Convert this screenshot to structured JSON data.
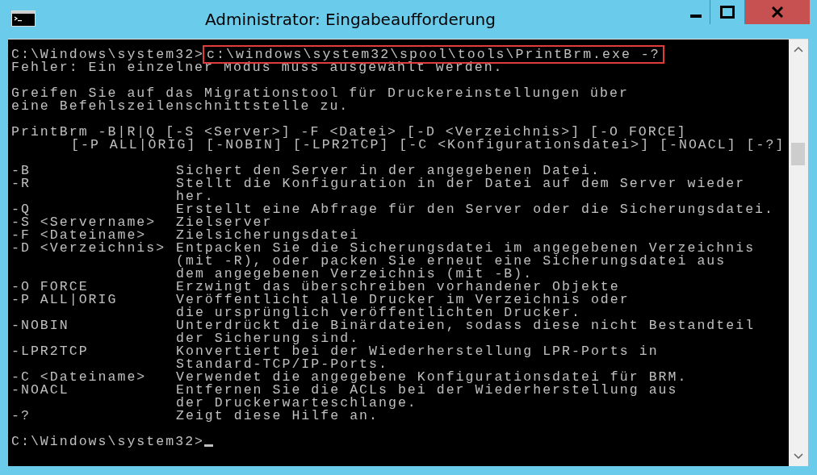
{
  "window": {
    "title": "Administrator: Eingabeaufforderung"
  },
  "prompt": {
    "path": "C:\\Windows\\system32>",
    "command": "c:\\windows\\system32\\spool\\tools\\PrintBrm.exe -?",
    "highlighted": true
  },
  "blocks": [
    {
      "gap_before": false,
      "lines": [
        {
          "text": "Fehler: Ein einzelner Modus muss ausgewählt werden.",
          "continuation": false
        }
      ]
    },
    {
      "gap_before": true,
      "lines": [
        {
          "text": "Greifen Sie auf das Migrationstool für Druckereinstellungen über",
          "continuation": false
        },
        {
          "text": "eine Befehlszeilenschnittstelle zu.",
          "continuation": false
        }
      ]
    },
    {
      "gap_before": true,
      "lines": [
        {
          "text": "PrintBrm -B|R|Q [-S <Server>] -F <Datei> [-D <Verzeichnis>] [-O FORCE]",
          "continuation": false
        },
        {
          "text": "[-P ALL|ORIG] [-NOBIN] [-LPR2TCP] [-C <Konfigurationsdatei>] [-NOACL] [-?]",
          "continuation": true
        }
      ]
    }
  ],
  "options": [
    {
      "flag": "-B",
      "description": [
        "Sichert den Server in der angegebenen Datei."
      ]
    },
    {
      "flag": "-R",
      "description": [
        "Stellt die Konfiguration in der Datei auf dem Server wieder",
        "her."
      ]
    },
    {
      "flag": "-Q",
      "description": [
        "Erstellt eine Abfrage für den Server oder die Sicherungsdatei."
      ]
    },
    {
      "flag": "-S <Servername>",
      "description": [
        "Zielserver"
      ]
    },
    {
      "flag": "-F <Dateiname>",
      "description": [
        "Zielsicherungsdatei"
      ]
    },
    {
      "flag": "-D <Verzeichnis>",
      "description": [
        "Entpacken Sie die Sicherungsdatei im angegebenen Verzeichnis",
        "(mit -R), oder packen Sie erneut eine Sicherungsdatei aus",
        "dem angegebenen Verzeichnis (mit -B)."
      ]
    },
    {
      "flag": "-O FORCE",
      "description": [
        "Erzwingt das überschreiben vorhandener Objekte"
      ]
    },
    {
      "flag": "-P ALL|ORIG",
      "description": [
        "Veröffentlicht alle Drucker im Verzeichnis oder",
        "die ursprünglich veröffentlichten Drucker."
      ]
    },
    {
      "flag": "-NOBIN",
      "description": [
        "Unterdrückt die Binärdateien, sodass diese nicht Bestandteil",
        "der Sicherung sind."
      ]
    },
    {
      "flag": "-LPR2TCP",
      "description": [
        "Konvertiert bei der Wiederherstellung LPR-Ports in",
        "Standard-TCP/IP-Ports."
      ]
    },
    {
      "flag": "-C <Dateiname>",
      "description": [
        "Verwendet die angegebene Konfigurationsdatei für BRM."
      ]
    },
    {
      "flag": "-NOACL",
      "description": [
        "Entfernen Sie die ACLs bei der Wiederherstellung aus",
        "der Druckerwarteschlange."
      ]
    },
    {
      "flag": "-?",
      "description": [
        "Zeigt diese Hilfe an."
      ]
    }
  ],
  "final_prompt": {
    "path": "C:\\Windows\\system32>",
    "cursor": true
  }
}
